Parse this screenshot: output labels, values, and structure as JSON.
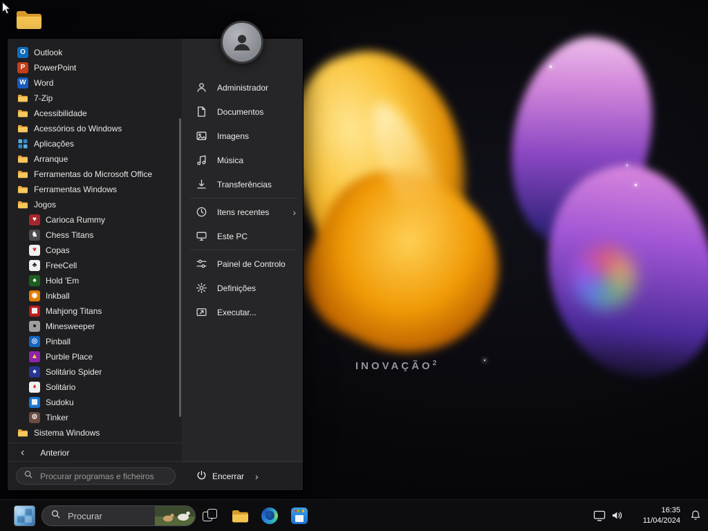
{
  "desktop": {
    "wallpaper_caption": "INOVAÇÃO",
    "wallpaper_caption_exp": "2"
  },
  "colors": {
    "menu_bg": "#1f1f21",
    "taskbar_bg": "#0d0d10",
    "folder_yellow": "#f8c85c"
  },
  "start_menu": {
    "programs": [
      {
        "label": "Outlook",
        "icon": "outlook-icon",
        "indent": false
      },
      {
        "label": "PowerPoint",
        "icon": "powerpoint-icon",
        "indent": false
      },
      {
        "label": "Word",
        "icon": "word-icon",
        "indent": false
      },
      {
        "label": "7-Zip",
        "icon": "folder-icon",
        "indent": false
      },
      {
        "label": "Acessibilidade",
        "icon": "folder-icon",
        "indent": false
      },
      {
        "label": "Acessórios do Windows",
        "icon": "folder-icon",
        "indent": false
      },
      {
        "label": "Aplicações",
        "icon": "apps-icon",
        "indent": false
      },
      {
        "label": "Arranque",
        "icon": "folder-icon",
        "indent": false
      },
      {
        "label": "Ferramentas do Microsoft Office",
        "icon": "folder-icon",
        "indent": false
      },
      {
        "label": "Ferramentas Windows",
        "icon": "folder-icon",
        "indent": false
      },
      {
        "label": "Jogos",
        "icon": "folder-icon",
        "indent": false
      },
      {
        "label": "Carioca Rummy",
        "icon": "carioca-rummy-icon",
        "indent": true
      },
      {
        "label": "Chess Titans",
        "icon": "chess-titans-icon",
        "indent": true
      },
      {
        "label": "Copas",
        "icon": "copas-icon",
        "indent": true
      },
      {
        "label": "FreeCell",
        "icon": "freecell-icon",
        "indent": true
      },
      {
        "label": "Hold 'Em",
        "icon": "holdem-icon",
        "indent": true
      },
      {
        "label": "Inkball",
        "icon": "inkball-icon",
        "indent": true
      },
      {
        "label": "Mahjong Titans",
        "icon": "mahjong-titans-icon",
        "indent": true
      },
      {
        "label": "Minesweeper",
        "icon": "minesweeper-icon",
        "indent": true
      },
      {
        "label": "Pinball",
        "icon": "pinball-icon",
        "indent": true
      },
      {
        "label": "Purble Place",
        "icon": "purble-place-icon",
        "indent": true
      },
      {
        "label": "Solitário Spider",
        "icon": "solitaire-spider-icon",
        "indent": true
      },
      {
        "label": "Solitário",
        "icon": "solitaire-icon",
        "indent": true
      },
      {
        "label": "Sudoku",
        "icon": "sudoku-icon",
        "indent": true
      },
      {
        "label": "Tinker",
        "icon": "tinker-icon",
        "indent": true
      },
      {
        "label": "Sistema Windows",
        "icon": "folder-icon",
        "indent": false
      }
    ],
    "back_label": "Anterior",
    "search_placeholder": "Procurar programas e ficheiros",
    "shutdown_label": "Encerrar",
    "user_items": [
      {
        "label": "Administrador",
        "icon": "user-icon"
      },
      {
        "label": "Documentos",
        "icon": "document-icon"
      },
      {
        "label": "Imagens",
        "icon": "image-icon"
      },
      {
        "label": "Música",
        "icon": "music-icon"
      },
      {
        "label": "Transferências",
        "icon": "download-icon"
      },
      {
        "label": "Itens recentes",
        "icon": "clock-icon",
        "chevron": true,
        "separator_before": true
      },
      {
        "label": "Este PC",
        "icon": "pc-icon"
      },
      {
        "label": "Painel de Controlo",
        "icon": "control-panel-icon",
        "separator_before": true
      },
      {
        "label": "Definições",
        "icon": "settings-icon"
      },
      {
        "label": "Executar...",
        "icon": "run-icon"
      }
    ]
  },
  "taskbar": {
    "search_placeholder": "Procurar",
    "tray": {
      "time": "16:35",
      "date": "11/04/2024"
    }
  }
}
